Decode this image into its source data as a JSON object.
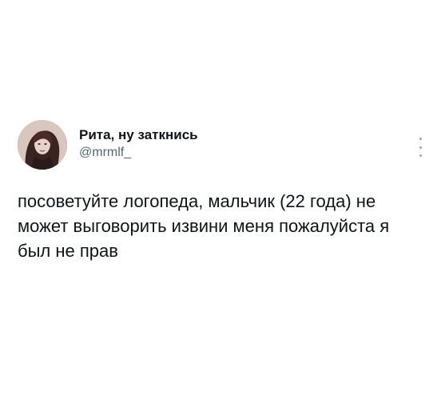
{
  "tweet": {
    "display_name": "Рита, ну заткнись",
    "handle": "@mrmlf_",
    "text": "посоветуйте логопеда, мальчик (22 года) не может выговорить извини меня пожалуйста я был не прав",
    "avatar_icon": "profile-photo",
    "more_icon": "more-vertical-icon"
  }
}
